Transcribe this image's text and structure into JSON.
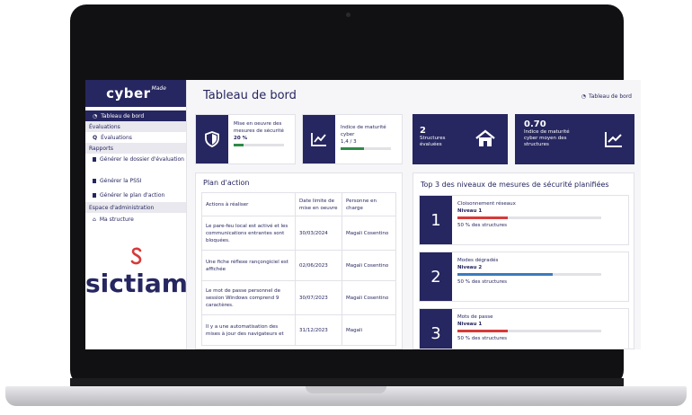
{
  "sidebar": {
    "logo_text": "cyber",
    "logo_sup": "Made",
    "items": [
      {
        "label": "Tableau de bord",
        "active": true,
        "icon": "dashboard-icon"
      },
      {
        "section": "Évaluations"
      },
      {
        "label": "Évaluations",
        "icon": "search-icon"
      },
      {
        "section": "Rapports"
      },
      {
        "label": "Générer le dossier d'évaluation",
        "icon": "document-icon"
      },
      {
        "label": "Générer la PSSI",
        "icon": "document-icon"
      },
      {
        "label": "Générer le plan d'action",
        "icon": "document-icon"
      },
      {
        "section": "Espace d'administration"
      },
      {
        "label": "Ma structure",
        "icon": "home-icon"
      }
    ],
    "partner_logo": "sictiam"
  },
  "header": {
    "title": "Tableau de bord",
    "breadcrumb": "Tableau de bord"
  },
  "kpis": [
    {
      "text": "Mise en oeuvre des mesures de sécurité",
      "value": "20 %",
      "progress": 0.2,
      "icon": "shield-icon"
    },
    {
      "text": "Indice de maturité cyber",
      "value": "1,4 / 3",
      "progress": 0.47,
      "icon": "trend-chart-icon"
    },
    {
      "value": "2",
      "text": "Structures évaluées",
      "icon": "house-icon"
    },
    {
      "value": "0.70",
      "text": "Indice de maturité cyber moyen des structures",
      "icon": "trend-chart-icon"
    }
  ],
  "action_plan": {
    "title": "Plan d'action",
    "columns": [
      "Actions à réaliser",
      "Date limite de mise en oeuvre",
      "Personne en charge"
    ],
    "rows": [
      [
        "Le pare-feu local est activé et les communications entrantes sont bloquées.",
        "30/03/2024",
        "Magali Cosentino"
      ],
      [
        "Une fiche réflexe rançongiciel est affichée",
        "02/06/2023",
        "Magali Cosentino"
      ],
      [
        "Le mot de passe personnel de session Windows comprend 9 caractères.",
        "30/07/2023",
        "Magali Cosentino"
      ],
      [
        "Il y a une automatisation des mises à jour des navigateurs et",
        "31/12/2023",
        "Magali"
      ]
    ]
  },
  "top3": {
    "title": "Top 3 des niveaux de mesures de sécurité planifiées",
    "items": [
      {
        "rank": "1",
        "name": "Cloisonnement réseaux",
        "level": "Niveau 1",
        "share": "50 % des structures",
        "progress": 0.5,
        "color": "#d73a3a"
      },
      {
        "rank": "2",
        "name": "Modes dégradés",
        "level": "Niveau 2",
        "share": "50 % des structures",
        "progress": 0.66,
        "color": "#3b7bbf"
      },
      {
        "rank": "3",
        "name": "Mots de passe",
        "level": "Niveau 1",
        "share": "50 % des structures",
        "progress": 0.5,
        "color": "#d73a3a"
      }
    ]
  }
}
